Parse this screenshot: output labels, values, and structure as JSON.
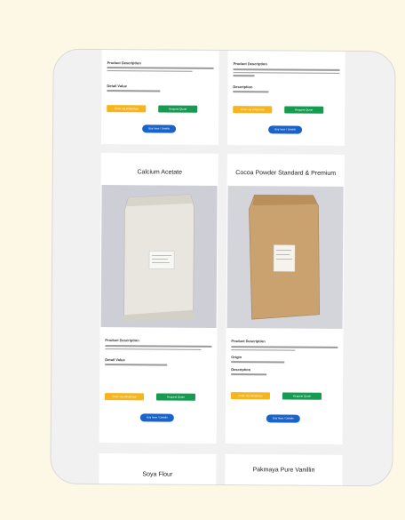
{
  "products": [
    {
      "title": "",
      "desc_heading": "Product Description",
      "desc_text": "",
      "detail_heading": "Detail Value",
      "detail_text": "",
      "btn_whatsapp": "Order via WhatsApp",
      "btn_request": "Request Quote",
      "btn_more": "Buy Now / Details"
    },
    {
      "title": "",
      "desc_heading": "Product Description",
      "desc_text": "",
      "detail_heading": "Description",
      "detail_text": "",
      "btn_whatsapp": "Order via WhatsApp",
      "btn_request": "Request Quote",
      "btn_more": "Buy Now / Details"
    },
    {
      "title": "Calcium Acetate",
      "desc_heading": "Product Description",
      "desc_text": "",
      "detail_heading": "Detail Value",
      "detail_text": "",
      "btn_whatsapp": "Order via WhatsApp",
      "btn_request": "Request Quote",
      "btn_more": "Buy Now / Details"
    },
    {
      "title": "Cocoa Powder Standard & Premium",
      "desc_heading": "Product Description",
      "desc_text": "",
      "detail_heading": "Origin",
      "detail_text": "",
      "detail2_heading": "Description",
      "detail2_text": "",
      "btn_whatsapp": "Order via WhatsApp",
      "btn_request": "Request Quote",
      "btn_more": "Buy Now / Details"
    },
    {
      "title": "Soya Flour"
    },
    {
      "title": "Pakmaya Pure Vanillin"
    }
  ],
  "colors": {
    "page_bg": "#fdf8e6",
    "whatsapp": "#f6b51d",
    "request": "#169c50",
    "more": "#1a63c9"
  }
}
